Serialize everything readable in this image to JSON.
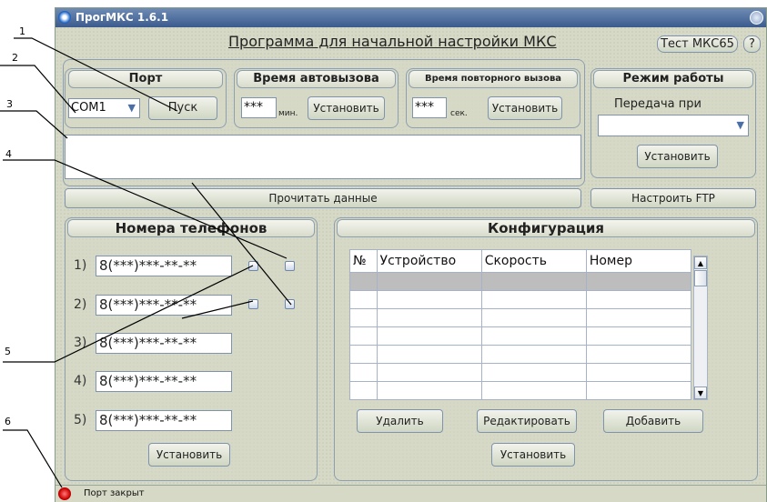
{
  "window": {
    "title": "ПрогМКС 1.6.1"
  },
  "header": {
    "title": "Программа для начальной настройки МКС",
    "test_button": "Тест МКС65",
    "help_button": "?"
  },
  "port": {
    "heading": "Порт",
    "value": "COM1",
    "start_button": "Пуск"
  },
  "autocall": {
    "heading": "Время автовызова",
    "value": "***",
    "unit": "мин.",
    "set_button": "Установить"
  },
  "recall": {
    "heading": "Время повторного вызова",
    "value": "***",
    "unit": "сек.",
    "set_button": "Установить"
  },
  "mode": {
    "heading": "Режим работы",
    "label": "Передача при",
    "value": "",
    "set_button": "Установить"
  },
  "read_button": "Прочитать данные",
  "ftp_button": "Настроить FTP",
  "phones": {
    "heading": "Номера телефонов",
    "items": [
      {
        "num": "1)",
        "value": "8(***)***-**-**"
      },
      {
        "num": "2)",
        "value": "8(***)***-**-**"
      },
      {
        "num": "3)",
        "value": "8(***)***-**-**"
      },
      {
        "num": "4)",
        "value": "8(***)***-**-**"
      },
      {
        "num": "5)",
        "value": "8(***)***-**-**"
      }
    ],
    "set_button": "Установить"
  },
  "config": {
    "heading": "Конфигурация",
    "columns": [
      "№",
      "Устройство",
      "Скорость",
      "Номер"
    ],
    "delete_button": "Удалить",
    "edit_button": "Редактировать",
    "add_button": "Добавить",
    "set_button": "Установить"
  },
  "status": {
    "text": "Порт закрыт",
    "indicator_color": "#cc0000"
  },
  "callouts": [
    "1",
    "2",
    "3",
    "4",
    "5",
    "6"
  ]
}
